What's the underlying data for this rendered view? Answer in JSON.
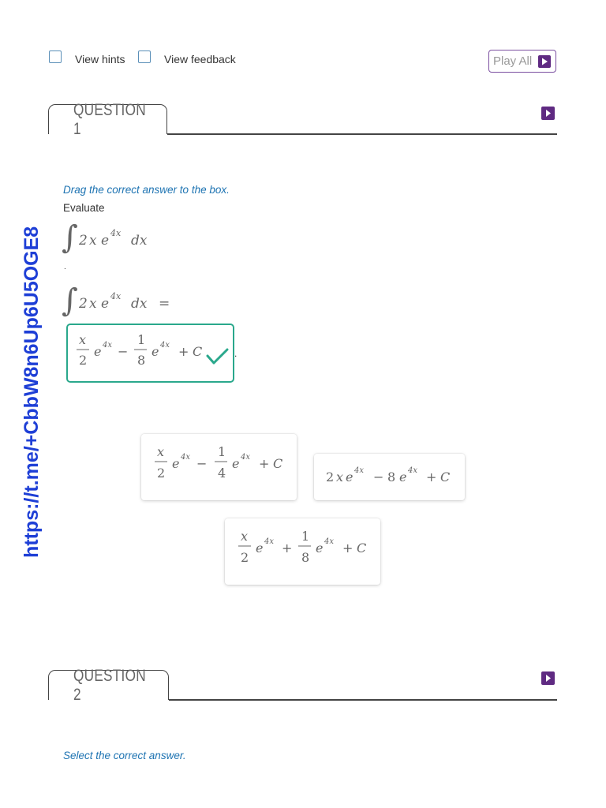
{
  "top": {
    "view_hints": "View hints",
    "view_feedback": "View feedback",
    "play_all": "Play All"
  },
  "question1": {
    "title": "QUESTION 1",
    "instruction": "Drag the correct answer to the box.",
    "prompt": "Evaluate",
    "integrand": "2x e^{4x} dx",
    "equation": "∫ 2x e^{4x} dx =",
    "placed_answer": "x/2 e^{4x} − 1/8 e^{4x} + C",
    "placed_status": "correct",
    "options": [
      "x/2 e^{4x} − 1/4 e^{4x} + C",
      "2x e^{4x} − 8 e^{4x} + C",
      "x/2 e^{4x} + 1/8 e^{4x} + C"
    ]
  },
  "question2": {
    "title": "QUESTION 2",
    "instruction": "Select the correct answer."
  },
  "watermark": "https://t.me/+CbbW8n6Up6U5OGE8",
  "colors": {
    "accent_purple": "#5f2a82",
    "instruction_blue": "#1d73b2",
    "correct_green": "#2aa88c",
    "watermark_blue": "#1e3fd6"
  },
  "icons": [
    "checkbox-icon",
    "play-icon",
    "checkmark-icon"
  ]
}
